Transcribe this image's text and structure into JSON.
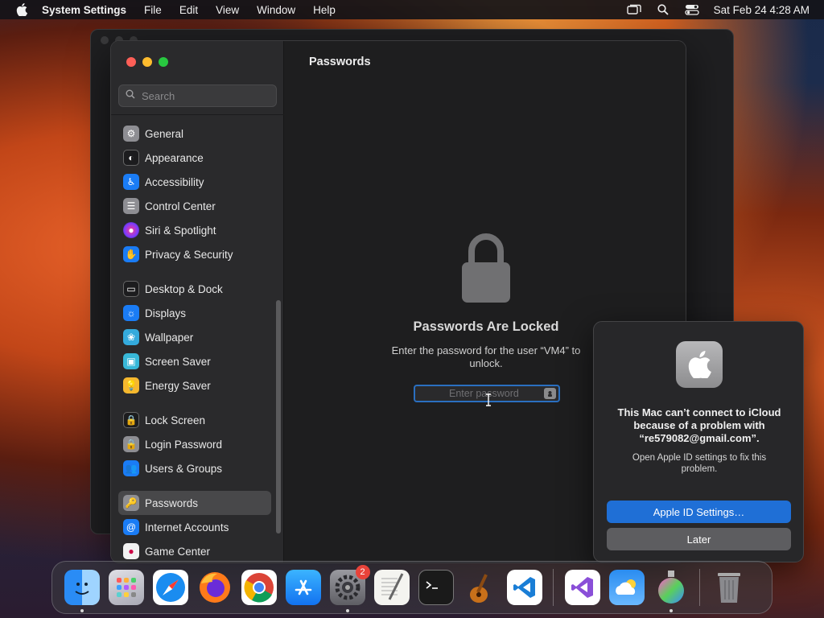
{
  "menubar": {
    "app_name": "System Settings",
    "menus": [
      "File",
      "Edit",
      "View",
      "Window",
      "Help"
    ],
    "datetime": "Sat Feb 24  4:28 AM"
  },
  "sidebar": {
    "search_placeholder": "Search",
    "items": [
      {
        "label": "General",
        "icon": "gear-icon",
        "color": "#8e8e93"
      },
      {
        "label": "Appearance",
        "icon": "appearance-icon",
        "color": "#1c1c1e"
      },
      {
        "label": "Accessibility",
        "icon": "accessibility-icon",
        "color": "#1a7cf5"
      },
      {
        "label": "Control Center",
        "icon": "control-center-icon",
        "color": "#8e8e93"
      },
      {
        "label": "Siri & Spotlight",
        "icon": "siri-icon",
        "color": "#b43cd8"
      },
      {
        "label": "Privacy & Security",
        "icon": "hand-icon",
        "color": "#1a7cf5"
      },
      {
        "label": "Desktop & Dock",
        "icon": "desktop-dock-icon",
        "color": "#1c1c1e"
      },
      {
        "label": "Displays",
        "icon": "displays-icon",
        "color": "#1a7cf5"
      },
      {
        "label": "Wallpaper",
        "icon": "wallpaper-icon",
        "color": "#34aadc"
      },
      {
        "label": "Screen Saver",
        "icon": "screen-saver-icon",
        "color": "#38b8d8"
      },
      {
        "label": "Energy Saver",
        "icon": "energy-saver-icon",
        "color": "#f5b82e"
      },
      {
        "label": "Lock Screen",
        "icon": "lock-screen-icon",
        "color": "#1c1c1e"
      },
      {
        "label": "Login Password",
        "icon": "login-password-icon",
        "color": "#8e8e93"
      },
      {
        "label": "Users & Groups",
        "icon": "users-groups-icon",
        "color": "#1a7cf5"
      },
      {
        "label": "Passwords",
        "icon": "key-icon",
        "color": "#8e8e93",
        "active": true
      },
      {
        "label": "Internet Accounts",
        "icon": "at-icon",
        "color": "#1a7cf5"
      },
      {
        "label": "Game Center",
        "icon": "game-center-icon",
        "color": "#f2f2f2"
      }
    ]
  },
  "content": {
    "title": "Passwords",
    "locked_title": "Passwords Are Locked",
    "locked_desc": "Enter the password for the user “VM4” to unlock.",
    "password_placeholder": "Enter password"
  },
  "dialog": {
    "title": "This Mac can’t connect to iCloud because of a problem with “re579082@gmail.com”.",
    "message": "Open Apple ID settings to fix this problem.",
    "primary_button": "Apple ID Settings…",
    "secondary_button": "Later"
  },
  "dock": {
    "apps": [
      {
        "name": "Finder",
        "icon": "finder-icon",
        "running": true
      },
      {
        "name": "Launchpad",
        "icon": "launchpad-icon"
      },
      {
        "name": "Safari",
        "icon": "safari-icon"
      },
      {
        "name": "Firefox",
        "icon": "firefox-icon"
      },
      {
        "name": "Chrome",
        "icon": "chrome-icon"
      },
      {
        "name": "App Store",
        "icon": "app-store-icon"
      },
      {
        "name": "System Settings",
        "icon": "system-settings-icon",
        "running": true,
        "badge": "2"
      },
      {
        "name": "TextEdit",
        "icon": "textedit-icon"
      },
      {
        "name": "Terminal",
        "icon": "terminal-icon"
      },
      {
        "name": "GarageBand",
        "icon": "garageband-icon"
      },
      {
        "name": "VS Code",
        "icon": "vscode-icon"
      },
      {
        "name": "Visual Studio",
        "icon": "visual-studio-icon"
      },
      {
        "name": "Weather",
        "icon": "weather-icon"
      },
      {
        "name": "Disk Utility",
        "icon": "disk-utility-icon",
        "running": true
      },
      {
        "name": "Trash",
        "icon": "trash-icon"
      }
    ]
  }
}
